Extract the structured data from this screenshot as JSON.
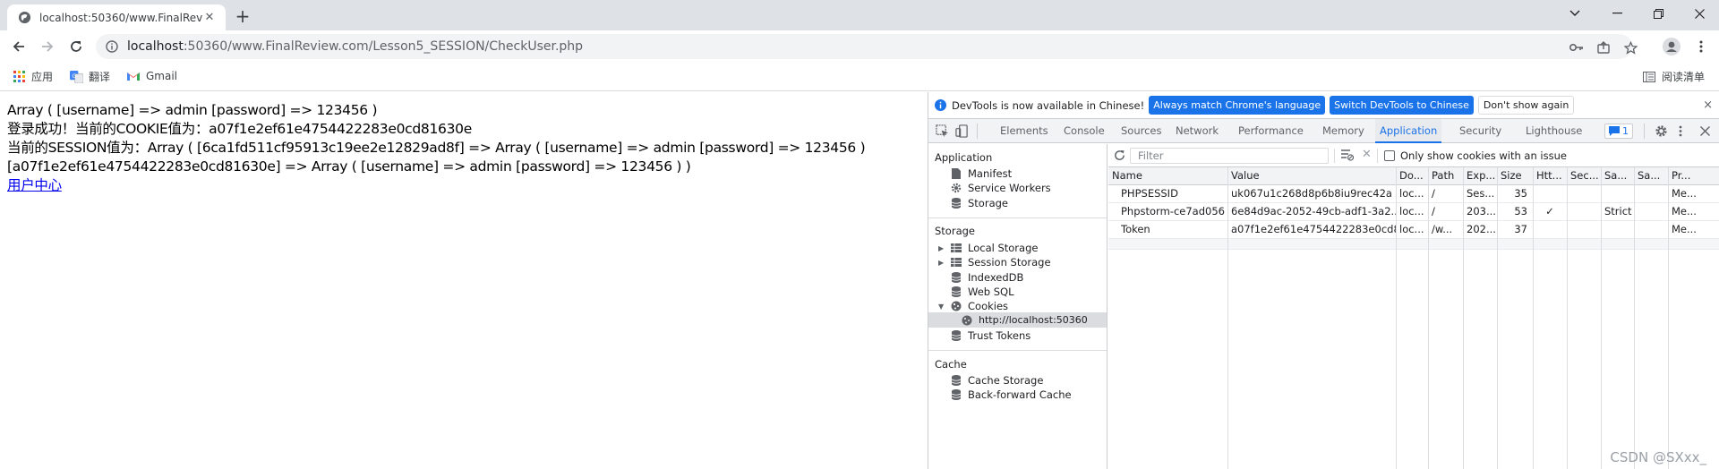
{
  "browser": {
    "tab_title": "localhost:50360/www.FinalRevi",
    "new_tab": "+",
    "url_host": "localhost",
    "url_rest": ":50360/www.FinalReview.com/Lesson5_SESSION/CheckUser.php"
  },
  "bookmarks": {
    "apps": "应用",
    "translate": "翻译",
    "gmail": "Gmail",
    "reading_list": "阅读清单"
  },
  "page": {
    "line1": "Array ( [username] => admin [password] => 123456 )",
    "line2": "登录成功！当前的COOKIE值为：a07f1e2ef61e4754422283e0cd81630e",
    "line3": "当前的SESSION值为：Array ( [6ca1fd511cf95913c19ee2e12829ad8f] => Array ( [username] => admin [password] => 123456 )",
    "line4": "[a07f1e2ef61e4754422283e0cd81630e] => Array ( [username] => admin [password] => 123456 ) )",
    "link": "用户中心"
  },
  "devtools": {
    "infobar": {
      "message": "DevTools is now available in Chinese!",
      "btn_match": "Always match Chrome's language",
      "btn_switch": "Switch DevTools to Chinese",
      "btn_dismiss": "Don't show again",
      "close": "×"
    },
    "tabs": [
      "Elements",
      "Console",
      "Sources",
      "Network",
      "Performance",
      "Memory",
      "Application",
      "Security",
      "Lighthouse"
    ],
    "issues_count": "1",
    "sidebar": {
      "application_header": "Application",
      "manifest": "Manifest",
      "service_workers": "Service Workers",
      "storage_item": "Storage",
      "storage_header": "Storage",
      "local_storage": "Local Storage",
      "session_storage": "Session Storage",
      "indexeddb": "IndexedDB",
      "websql": "Web SQL",
      "cookies": "Cookies",
      "cookie_origin": "http://localhost:50360",
      "trust_tokens": "Trust Tokens",
      "cache_header": "Cache",
      "cache_storage": "Cache Storage",
      "bfcache": "Back-forward Cache"
    },
    "cookies": {
      "filter_placeholder": "Filter",
      "only_issues": "Only show cookies with an issue",
      "columns": [
        "Name",
        "Value",
        "Do...",
        "Path",
        "Exp...",
        "Size",
        "Htt...",
        "Sec...",
        "Sa...",
        "Sa...",
        "Pr..."
      ],
      "rows": [
        [
          "PHPSESSID",
          "uk067u1c268d8p6b8iu9rec42a",
          "loc...",
          "/",
          "Ses...",
          "35",
          "",
          "",
          "",
          "",
          "Me..."
        ],
        [
          "Phpstorm-ce7ad056",
          "6e84d9ac-2052-49cb-adf1-3a2...",
          "loc...",
          "/",
          "203...",
          "53",
          "✓",
          "",
          "Strict",
          "",
          "Me..."
        ],
        [
          "Token",
          "a07f1e2ef61e4754422283e0cd8...",
          "loc...",
          "/w...",
          "202...",
          "37",
          "",
          "",
          "",
          "",
          "Me..."
        ]
      ]
    }
  },
  "watermark": "CSDN @SXxx_"
}
